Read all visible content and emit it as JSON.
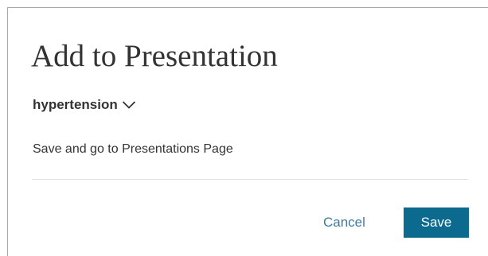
{
  "dialog": {
    "title": "Add to Presentation",
    "presentation": {
      "selected": "hypertension",
      "icon": "chevron-down-icon"
    },
    "save_and_go_label": "Save and go to Presentations Page",
    "actions": {
      "cancel_label": "Cancel",
      "save_label": "Save"
    }
  },
  "colors": {
    "link": "#3f7aa0",
    "primary_button": "#0b6a8e",
    "text": "#333333",
    "divider": "#dddddd",
    "border": "#a9a9a9"
  }
}
